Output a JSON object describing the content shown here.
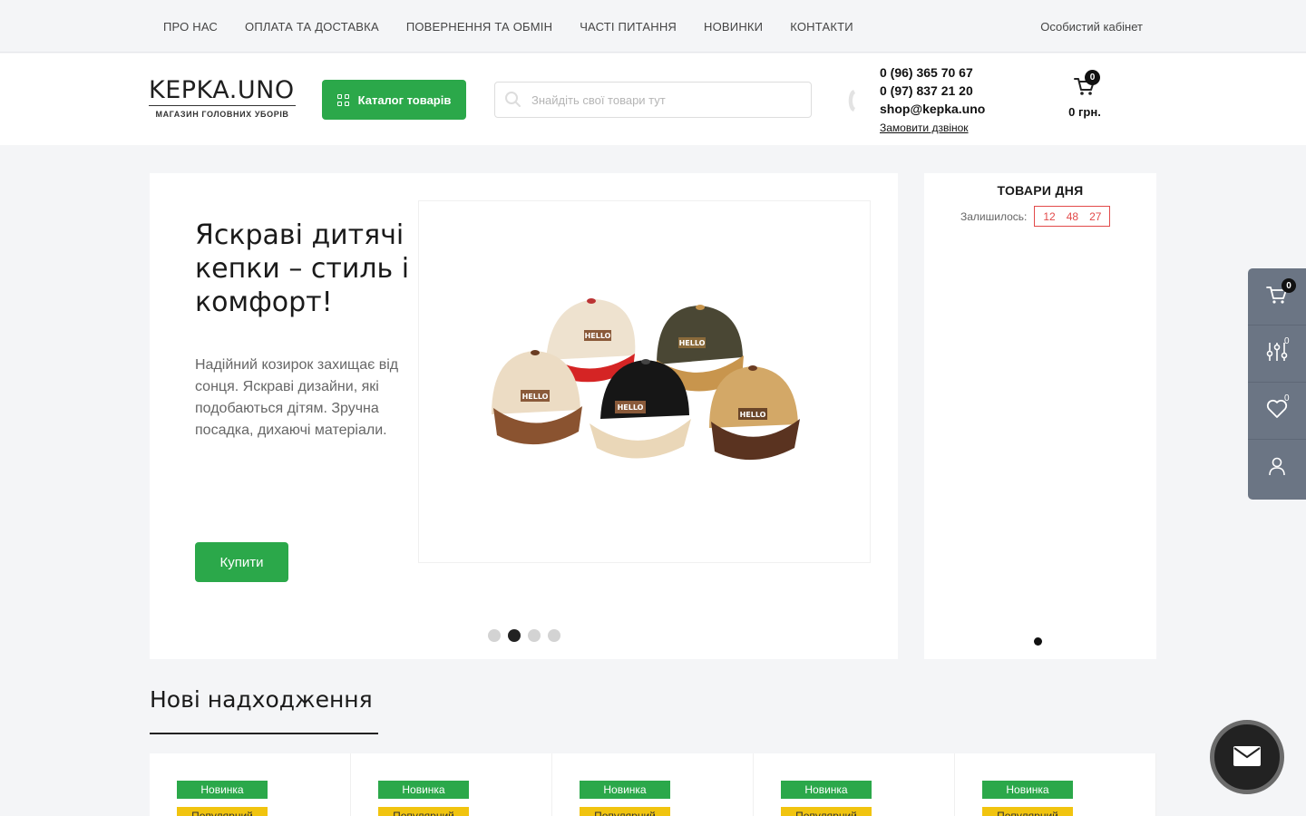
{
  "topnav": {
    "items": [
      {
        "label": "ПРО НАС"
      },
      {
        "label": "ОПЛАТА ТА ДОСТАВКА"
      },
      {
        "label": "ПОВЕРНЕННЯ ТА ОБМІН"
      },
      {
        "label": "ЧАСТІ ПИТАННЯ"
      },
      {
        "label": "НОВИНКИ"
      },
      {
        "label": "КОНТАКТИ"
      }
    ],
    "account": "Особистий кабінет"
  },
  "header": {
    "logo_main": "KEPKA.UNO",
    "logo_sub": "МАГАЗИН ГОЛОВНИХ УБОРІВ",
    "catalog_label": "Каталог товарів",
    "search_placeholder": "Знайдіть свої товари тут",
    "phone1": "0 (96) 365 70 67",
    "phone2": "0 (97) 837 21 20",
    "email": "shop@kepka.uno",
    "callback": "Замовити дзвінок",
    "cart_count": "0",
    "cart_total": "0 грн."
  },
  "hero": {
    "title": "Яскраві дитячі кепки – стиль і комфорт!",
    "text": "Надійний козирок захищає від сонця. Яскраві дизайни, які подобаються дітям. Зручна посадка, дихаючі матеріали.",
    "button": "Купити",
    "slides": 4,
    "active_slide": 2,
    "image_text": "HELLO"
  },
  "deals": {
    "title": "ТОВАРИ ДНЯ",
    "remaining_label": "Залишилось:",
    "timer": {
      "h": "12",
      "m": "48",
      "s": "27"
    }
  },
  "side_panel": {
    "cart_count": "0",
    "compare_count": "0",
    "wishlist_count": "0"
  },
  "new_arrivals": {
    "title": "Нові надходження",
    "products": [
      {
        "tag1": "Новинка",
        "tag2": "Популярний"
      },
      {
        "tag1": "Новинка",
        "tag2": "Популярний"
      },
      {
        "tag1": "Новинка",
        "tag2": "Популярний"
      },
      {
        "tag1": "Новинка",
        "tag2": "Популярний"
      },
      {
        "tag1": "Новинка",
        "tag2": "Популярний"
      }
    ]
  },
  "colors": {
    "accent_green": "#2ba84a",
    "timer_red": "#e24a4a",
    "side_panel": "#6b7584",
    "popular_yellow": "#f1c40f"
  },
  "icons": [
    "grid-icon",
    "search-icon",
    "phone-icon",
    "cart-icon",
    "compare-icon",
    "heart-icon",
    "user-icon",
    "mail-icon"
  ]
}
